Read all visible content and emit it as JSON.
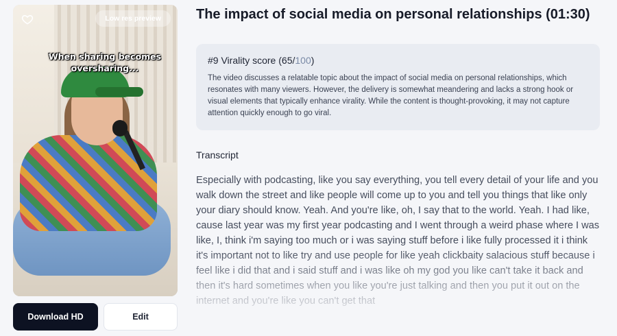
{
  "video": {
    "badge": "Low res preview",
    "caption": "When sharing becomes oversharing...",
    "icons": {
      "favorite": "heart-outline-icon"
    }
  },
  "buttons": {
    "download": "Download HD",
    "edit": "Edit"
  },
  "clip": {
    "title": "The impact of social media on personal relationships (01:30)"
  },
  "score": {
    "rank": "#9",
    "label": "Virality score",
    "value": "65",
    "max": "100",
    "description": "The video discusses a relatable topic about the impact of social media on personal relationships, which resonates with many viewers. However, the delivery is somewhat meandering and lacks a strong hook or visual elements that typically enhance virality. While the content is thought-provoking, it may not capture attention quickly enough to go viral."
  },
  "transcript": {
    "label": "Transcript",
    "text": "Especially with podcasting, like you say everything, you tell every detail of your life and you walk down the street and like people will come up to you and tell you things that like only your diary should know. Yeah. And you're like, oh, I say that to the world. Yeah. I had like, cause last year was my first year podcasting and I went through a weird phase where I was like, I, think i'm saying too much or i was saying stuff before i like fully processed it i think it's important not to like try and use people for like yeah clickbaity salacious stuff because i feel like i did that and i said stuff and i was like oh my god you like can't take it back and then it's hard sometimes when you like you're just talking and then you put it out on the internet and you're like you can't get that"
  },
  "colors": {
    "primary_button": "#0d1222",
    "card_bg": "#e9ecf2",
    "page_bg": "#f5f6f9"
  }
}
